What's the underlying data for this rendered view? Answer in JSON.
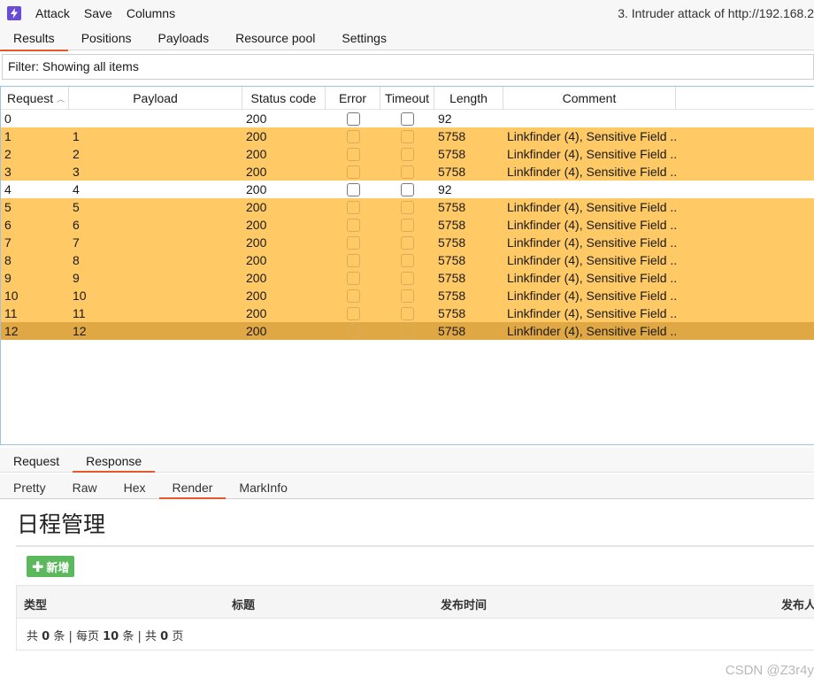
{
  "menubar": {
    "items": [
      "Attack",
      "Save",
      "Columns"
    ],
    "window_title": "3. Intruder attack of http://192.168.2"
  },
  "tabs": [
    "Results",
    "Positions",
    "Payloads",
    "Resource pool",
    "Settings"
  ],
  "active_tab": "Results",
  "filter": {
    "text": "Filter: Showing all items"
  },
  "results_table": {
    "columns": [
      "Request",
      "Payload",
      "Status code",
      "Error",
      "Timeout",
      "Length",
      "Comment"
    ],
    "rows": [
      {
        "request": "0",
        "payload": "",
        "status": "200",
        "error": false,
        "timeout": false,
        "length": "92",
        "comment": "",
        "highlight": "none"
      },
      {
        "request": "1",
        "payload": "1",
        "status": "200",
        "error": false,
        "timeout": false,
        "length": "5758",
        "comment": "Linkfinder (4), Sensitive Field ...",
        "highlight": "orange"
      },
      {
        "request": "2",
        "payload": "2",
        "status": "200",
        "error": false,
        "timeout": false,
        "length": "5758",
        "comment": "Linkfinder (4), Sensitive Field ...",
        "highlight": "orange"
      },
      {
        "request": "3",
        "payload": "3",
        "status": "200",
        "error": false,
        "timeout": false,
        "length": "5758",
        "comment": "Linkfinder (4), Sensitive Field ...",
        "highlight": "orange"
      },
      {
        "request": "4",
        "payload": "4",
        "status": "200",
        "error": false,
        "timeout": false,
        "length": "92",
        "comment": "",
        "highlight": "none"
      },
      {
        "request": "5",
        "payload": "5",
        "status": "200",
        "error": false,
        "timeout": false,
        "length": "5758",
        "comment": "Linkfinder (4), Sensitive Field ...",
        "highlight": "orange"
      },
      {
        "request": "6",
        "payload": "6",
        "status": "200",
        "error": false,
        "timeout": false,
        "length": "5758",
        "comment": "Linkfinder (4), Sensitive Field ...",
        "highlight": "orange"
      },
      {
        "request": "7",
        "payload": "7",
        "status": "200",
        "error": false,
        "timeout": false,
        "length": "5758",
        "comment": "Linkfinder (4), Sensitive Field ...",
        "highlight": "orange"
      },
      {
        "request": "8",
        "payload": "8",
        "status": "200",
        "error": false,
        "timeout": false,
        "length": "5758",
        "comment": "Linkfinder (4), Sensitive Field ...",
        "highlight": "orange"
      },
      {
        "request": "9",
        "payload": "9",
        "status": "200",
        "error": false,
        "timeout": false,
        "length": "5758",
        "comment": "Linkfinder (4), Sensitive Field ...",
        "highlight": "orange"
      },
      {
        "request": "10",
        "payload": "10",
        "status": "200",
        "error": false,
        "timeout": false,
        "length": "5758",
        "comment": "Linkfinder (4), Sensitive Field ...",
        "highlight": "orange"
      },
      {
        "request": "11",
        "payload": "11",
        "status": "200",
        "error": false,
        "timeout": false,
        "length": "5758",
        "comment": "Linkfinder (4), Sensitive Field ...",
        "highlight": "orange"
      },
      {
        "request": "12",
        "payload": "12",
        "status": "200",
        "error": false,
        "timeout": false,
        "length": "5758",
        "comment": "Linkfinder (4), Sensitive Field ...",
        "highlight": "selected"
      }
    ]
  },
  "message_tabs": [
    "Request",
    "Response"
  ],
  "active_message_tab": "Response",
  "view_tabs": [
    "Pretty",
    "Raw",
    "Hex",
    "Render",
    "MarkInfo"
  ],
  "active_view_tab": "Render",
  "render": {
    "title": "日程管理",
    "add_button": "新增",
    "table_headers": [
      "类型",
      "标题",
      "发布时间",
      "发布人"
    ],
    "pager": {
      "prefix": "共",
      "total": "0",
      "unit1": "条 | 每页",
      "per_page": "10",
      "unit2": "条 | 共",
      "pages": "0",
      "unit3": "页"
    }
  },
  "watermark": "CSDN @Z3r4y",
  "colors": {
    "highlight_orange": "#ffc966",
    "selected_row": "#e0a844",
    "tab_underline": "#e8582a",
    "add_button": "#5cb85c",
    "app_icon": "#6a4bd8"
  },
  "icons": {
    "app": "burp-lightning-icon",
    "sort": "sort-ascending-icon",
    "add": "plus-icon"
  }
}
